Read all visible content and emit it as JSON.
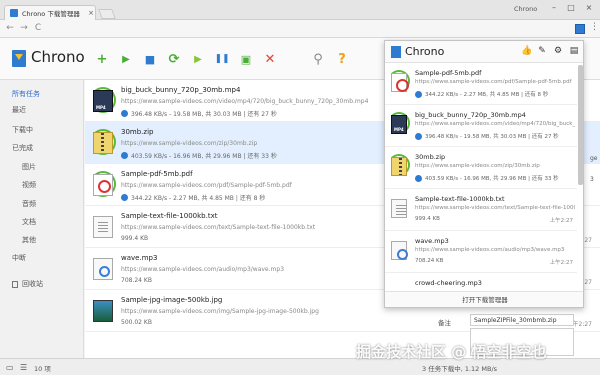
{
  "browser": {
    "tab_title": "Chrono 下载管理器",
    "tab_close": "×",
    "profile": "Chrono",
    "min": "–",
    "max": "□",
    "close": "×",
    "back": "←",
    "forward": "→",
    "reload": "C",
    "menu": "⋮"
  },
  "app": {
    "title": "Chrono",
    "toolbar_icons": [
      "add-icon",
      "play-icon",
      "stop-icon",
      "refresh-icon",
      "forward-icon",
      "columns-icon",
      "delete-all-icon",
      "close-icon",
      "search-icon",
      "help-icon"
    ],
    "toolbar_glyphs": {
      "add": "+",
      "play": "▶",
      "stop": "■",
      "refresh": "⟳",
      "forward": "▶",
      "columns": "❚❚",
      "delete_all": "▣",
      "close": "✕",
      "search": "⚲",
      "help": "?"
    }
  },
  "sidebar": {
    "items": [
      {
        "label": "所有任务",
        "active": true
      },
      {
        "label": "最近"
      },
      {
        "label": "下载中"
      },
      {
        "label": "已完成"
      },
      {
        "label": "图片"
      },
      {
        "label": "视频"
      },
      {
        "label": "音频"
      },
      {
        "label": "文档"
      },
      {
        "label": "其他"
      },
      {
        "label": "中断"
      },
      {
        "label": "回收站"
      }
    ]
  },
  "downloads": [
    {
      "name": "big_buck_bunny_720p_30mb.mp4",
      "url": "https://www.sample-videos.com/video/mp4/720/big_buck_bunny_720p_30mb.mp4",
      "status": "396.48 KB/s - 19.58 MB, 共 30.03 MB | 还有 27 秒",
      "time": "",
      "type": "mp4"
    },
    {
      "name": "30mb.zip",
      "url": "https://www.sample-videos.com/zip/30mb.zip",
      "status": "403.59 KB/s - 16.96 MB, 共 29.96 MB | 还有 33 秒",
      "time": "",
      "type": "zip"
    },
    {
      "name": "Sample-pdf-5mb.pdf",
      "url": "https://www.sample-videos.com/pdf/Sample-pdf-5mb.pdf",
      "status": "344.22 KB/s - 2.27 MB, 共 4.85 MB | 还有 8 秒",
      "time": "",
      "type": "pdf"
    },
    {
      "name": "Sample-text-file-1000kb.txt",
      "url": "https://www.sample-videos.com/text/Sample-text-file-1000kb.txt",
      "status": "999.4 KB",
      "time": "上午2:27",
      "type": "txt"
    },
    {
      "name": "wave.mp3",
      "url": "https://www.sample-videos.com/audio/mp3/wave.mp3",
      "status": "708.24 KB",
      "time": "上午2:27",
      "type": "mp3"
    },
    {
      "name": "Sample-jpg-image-500kb.jpg",
      "url": "https://www.sample-videos.com/img/Sample-jpg-image-500kb.jpg",
      "status": "500.02 KB",
      "time": "上午2:27",
      "type": "jpg"
    }
  ],
  "popup": {
    "title": "Chrono",
    "footer": "打开下载管理器",
    "items": [
      {
        "name": "Sample-pdf-5mb.pdf",
        "url": "https://www.sample-videos.com/pdf/Sample-pdf-5mb.pdf",
        "status": "344.22 KB/s - 2.27 MB, 共 4.85 MB | 还有 8 秒",
        "time": "",
        "type": "pdf"
      },
      {
        "name": "big_buck_bunny_720p_30mb.mp4",
        "url": "https://www.sample-videos.com/video/mp4/720/big_buck_bunny_720p_30mb.mp4",
        "status": "396.48 KB/s - 19.58 MB, 共 30.03 MB | 还有 27 秒",
        "time": "",
        "type": "mp4"
      },
      {
        "name": "30mb.zip",
        "url": "https://www.sample-videos.com/zip/30mb.zip",
        "status": "403.59 KB/s - 16.96 MB, 共 29.96 MB | 还有 33 秒",
        "time": "",
        "type": "zip"
      },
      {
        "name": "Sample-text-file-1000kb.txt",
        "url": "https://www.sample-videos.com/text/Sample-text-file-1000kb.txt",
        "status": "999.4 KB",
        "time": "上午2:27",
        "type": "txt"
      },
      {
        "name": "wave.mp3",
        "url": "https://www.sample-videos.com/audio/mp3/wave.mp3",
        "status": "708.24 KB",
        "time": "上午2:27",
        "type": "mp3"
      },
      {
        "name": "crowd-cheering.mp3",
        "url": "",
        "status": "",
        "time": "",
        "type": "mp3"
      }
    ]
  },
  "details": {
    "label": "备注",
    "value": "SampleZIPFile_30mbmb.zip"
  },
  "status_bar": {
    "count": "10 项",
    "summary": "3 任务下载中, 1.12 MB/s",
    "edge_ge": "ge",
    "edge_right": "3"
  },
  "watermark": "掘金技术社区 @ 悟空非空也",
  "colors": {
    "accent": "#2f7bd0",
    "progress": "#58b93a",
    "selected": "#e3efff",
    "active_sidebar": "#2a6ad0"
  }
}
